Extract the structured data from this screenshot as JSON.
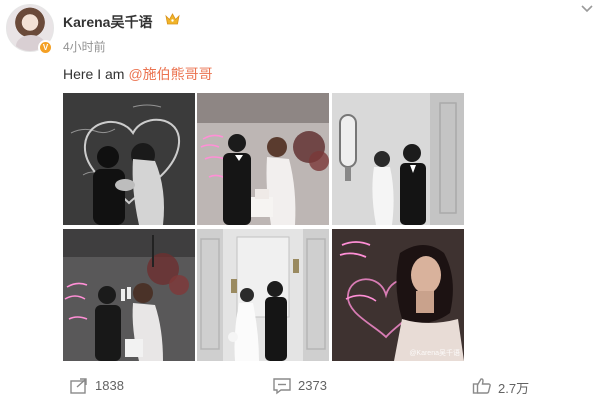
{
  "user": {
    "name": "Karena吴千语",
    "time": "4小时前"
  },
  "post": {
    "text": "Here I am",
    "mention": "@施伯熊哥哥",
    "watermark": "@Karena吴千语"
  },
  "photos": [
    {
      "icon": "wedding-kiss-bw"
    },
    {
      "icon": "cake-cutting"
    },
    {
      "icon": "couple-standing-bw"
    },
    {
      "icon": "couple-toast"
    },
    {
      "icon": "couple-walking-bw"
    },
    {
      "icon": "bride-smiling"
    }
  ],
  "actions": {
    "share_count": "1838",
    "comment_count": "2373",
    "like_count": "2.7万"
  },
  "colors": {
    "mention": "#eb7350",
    "verified_badge": "#f4a024",
    "crown": "#f0b429",
    "neon": "#ff8fd6"
  }
}
